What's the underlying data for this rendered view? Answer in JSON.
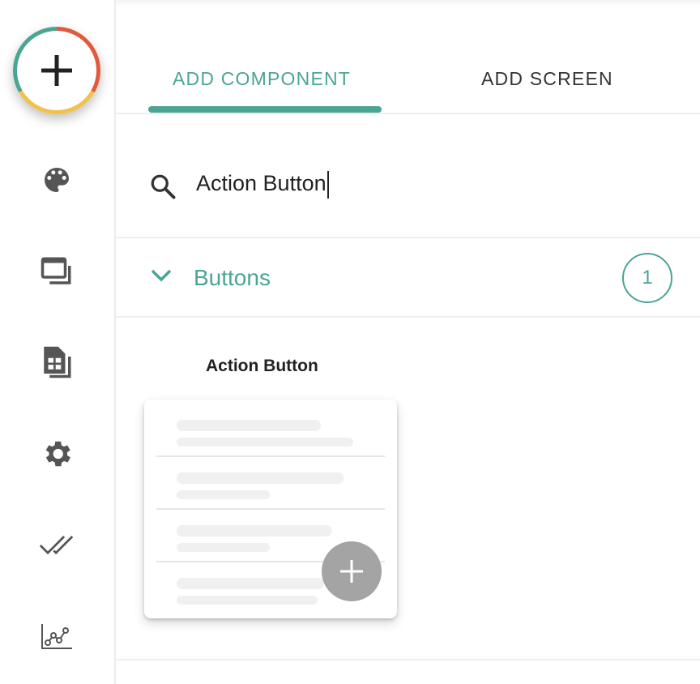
{
  "sidebar": {
    "items": [
      {
        "icon": "plus-icon"
      },
      {
        "icon": "palette-icon"
      },
      {
        "icon": "screens-icon"
      },
      {
        "icon": "data-table-icon"
      },
      {
        "icon": "gear-icon"
      },
      {
        "icon": "double-check-icon"
      },
      {
        "icon": "analytics-icon"
      }
    ]
  },
  "tabs": [
    {
      "label": "ADD COMPONENT",
      "active": true
    },
    {
      "label": "ADD SCREEN",
      "active": false
    }
  ],
  "search": {
    "value": "Action Button",
    "icon": "search-icon"
  },
  "group": {
    "label": "Buttons",
    "count": "1",
    "icon": "chevron-down-icon"
  },
  "component": {
    "title": "Action Button"
  },
  "colors": {
    "accent": "#4aa593",
    "red": "#e05a3d",
    "yellow": "#f0c24b"
  }
}
